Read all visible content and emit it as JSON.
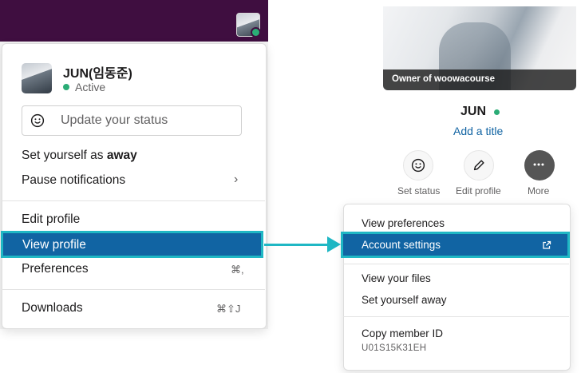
{
  "left_menu": {
    "user_name": "JUN(임동준)",
    "presence": "Active",
    "status_placeholder": "Update your status",
    "set_away_prefix": "Set yourself as ",
    "set_away_bold": "away",
    "pause_notifications": "Pause notifications",
    "pause_chevron": "›",
    "edit_profile": "Edit profile",
    "view_profile": "View profile",
    "preferences": "Preferences",
    "preferences_shortcut": "⌘,",
    "downloads": "Downloads",
    "downloads_shortcut": "⌘⇧J"
  },
  "profile_card": {
    "photo_caption": "Owner of woowacourse",
    "name": "JUN",
    "add_title": "Add a title",
    "actions": [
      {
        "label": "Set status",
        "icon": "smile-icon"
      },
      {
        "label": "Edit profile",
        "icon": "pencil-icon"
      },
      {
        "label": "More",
        "icon": "ellipsis-icon"
      }
    ]
  },
  "more_menu": {
    "view_preferences": "View preferences",
    "account_settings": "Account settings",
    "view_files": "View your files",
    "set_away": "Set yourself away",
    "copy_member_id": "Copy member ID",
    "member_id": "U01S15K31EH"
  },
  "colors": {
    "workspace_purple": "#3f0e40",
    "highlight_blue": "#1164a3",
    "annotation_teal": "#1fb7c4",
    "presence_green": "#2bac76"
  }
}
